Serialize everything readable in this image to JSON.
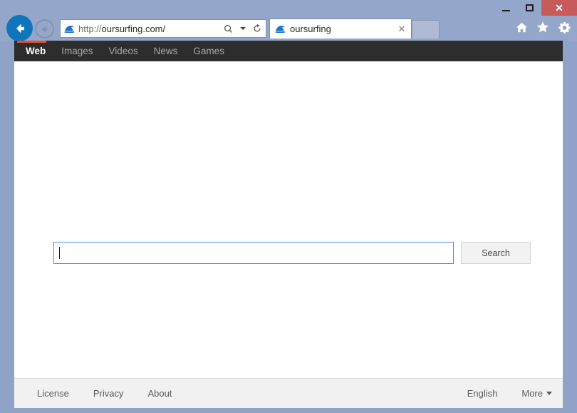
{
  "window": {
    "controls": {
      "minimize_label": "–",
      "maximize_label": "□",
      "close_label": "✕"
    }
  },
  "browser": {
    "back_icon": "back-arrow-icon",
    "forward_icon": "forward-arrow-icon",
    "address": {
      "scheme": "http://",
      "domain": "oursurfing.com/",
      "full_url": "http://oursurfing.com/",
      "favicon": "wave-icon",
      "search_icon": "search-icon",
      "dropdown_icon": "chevron-down-icon",
      "refresh_icon": "refresh-icon"
    },
    "tab": {
      "title": "oursurfing",
      "favicon": "wave-icon",
      "close_label": "✕"
    },
    "new_tab_label": "",
    "toolbar_icons": {
      "home": "home-icon",
      "favorites": "star-icon",
      "settings": "gear-icon"
    }
  },
  "site": {
    "nav": [
      {
        "label": "Web",
        "active": true
      },
      {
        "label": "Images",
        "active": false
      },
      {
        "label": "Videos",
        "active": false
      },
      {
        "label": "News",
        "active": false
      },
      {
        "label": "Games",
        "active": false
      }
    ],
    "search": {
      "value": "",
      "placeholder": "",
      "button_label": "Search"
    },
    "footer": {
      "links": [
        {
          "label": "License"
        },
        {
          "label": "Privacy"
        },
        {
          "label": "About"
        }
      ],
      "language": "English",
      "more_label": "More"
    }
  },
  "colors": {
    "chrome": "#94a7ca",
    "accent_orange": "#e8502a",
    "nav_dark": "#2d2d2d",
    "focus_blue": "#4a90e2",
    "back_blue": "#1076bc",
    "close_red": "#c75b5b"
  }
}
